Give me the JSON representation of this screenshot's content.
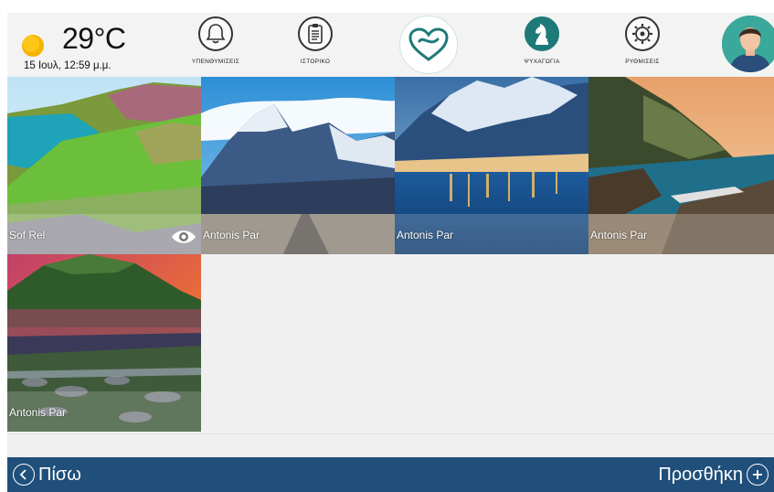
{
  "header": {
    "temperature": "29°C",
    "datetime": "15 Ιουλ, 12:59 μ.μ.",
    "weather_icon": "sun-icon",
    "nav": [
      {
        "label": "ΥΠΕΝΘΥΜΙΣΕΙΣ",
        "icon": "bell-icon",
        "active": false
      },
      {
        "label": "ΙΣΤΟΡΙΚΟ",
        "icon": "clipboard-icon",
        "active": false
      },
      {
        "label": "ΨΥΧΑΓΩΓΙΑ",
        "icon": "chess-knight-icon",
        "active": true
      },
      {
        "label": "ΡΥΘΜΙΣΕΙΣ",
        "icon": "gear-icon",
        "active": false
      }
    ],
    "logo_icon": "heart-logo-icon",
    "avatar_icon": "user-avatar-icon"
  },
  "gallery": {
    "tiles": [
      {
        "author": "Sof Rel",
        "scene": "green coastal cliffs",
        "has_eye": true
      },
      {
        "author": "Antonis Par",
        "scene": "snowy mountain peaks"
      },
      {
        "author": "Antonis Par",
        "scene": "harbour town at dusk"
      },
      {
        "author": "Antonis Par",
        "scene": "rocky coast at sunset"
      },
      {
        "author": "Antonis Par",
        "scene": "volcano over lake"
      }
    ]
  },
  "footer": {
    "back_label": "Πίσω",
    "add_label": "Προσθήκη"
  },
  "colors": {
    "accent": "#1e7a78",
    "footer_bg": "#1f4f7a",
    "page_bg": "#f0f0f0"
  }
}
